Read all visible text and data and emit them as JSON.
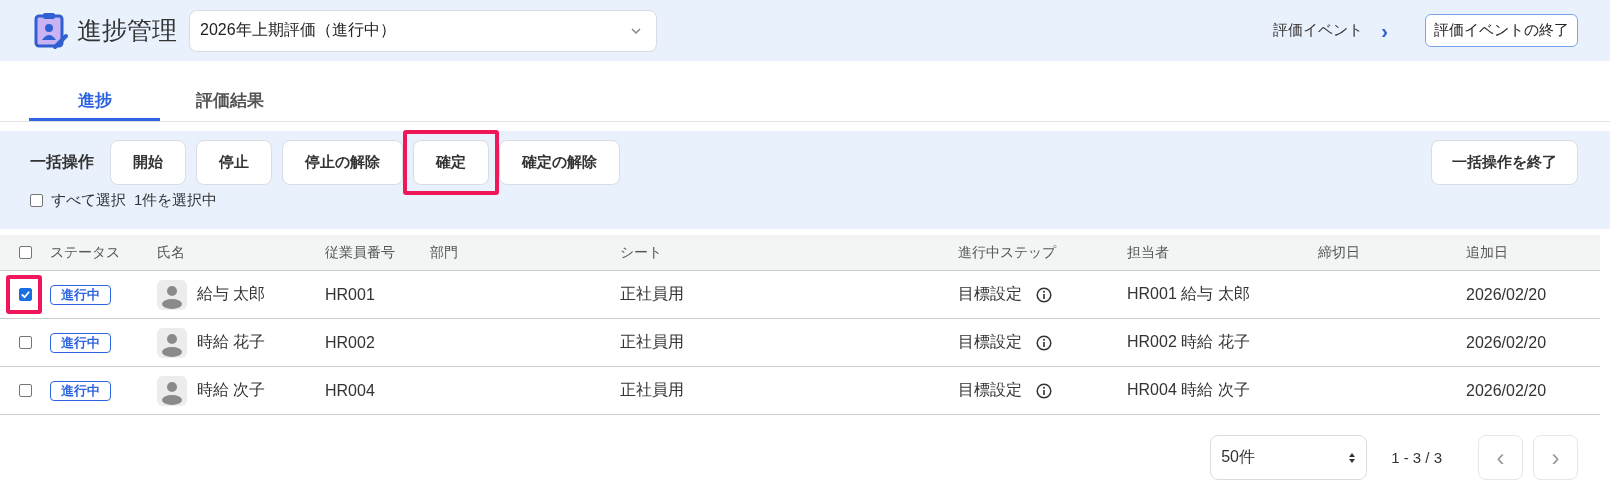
{
  "header": {
    "title": "進捗管理",
    "event_select": {
      "value": "2026年上期評価（進行中）"
    },
    "event_link": "評価イベント",
    "event_link_arrow": "›",
    "end_event_button": "評価イベントの終了"
  },
  "tabs": [
    {
      "label": "進捗",
      "selected": true
    },
    {
      "label": "評価結果",
      "selected": false
    }
  ],
  "bulk": {
    "label": "一括操作",
    "actions": [
      {
        "label": "開始",
        "highlighted": false
      },
      {
        "label": "停止",
        "highlighted": false
      },
      {
        "label": "停止の解除",
        "highlighted": false
      },
      {
        "label": "確定",
        "highlighted": true
      },
      {
        "label": "確定の解除",
        "highlighted": false
      }
    ],
    "end_button": "一括操作を終了",
    "select_all": {
      "label": "すべて選択",
      "checked": false
    },
    "selection_count": "1件を選択中"
  },
  "table": {
    "header_checked": false,
    "columns": [
      "ステータス",
      "氏名",
      "従業員番号",
      "部門",
      "シート",
      "進行中ステップ",
      "担当者",
      "締切日",
      "追加日"
    ],
    "rows": [
      {
        "checked": true,
        "highlighted": true,
        "status": "進行中",
        "name": "給与 太郎",
        "employee_no": "HR001",
        "sheet": "正社員用",
        "step": "目標設定",
        "assignee": "HR001 給与 太郎",
        "added": "2026/02/20"
      },
      {
        "checked": false,
        "highlighted": false,
        "status": "進行中",
        "name": "時給 花子",
        "employee_no": "HR002",
        "sheet": "正社員用",
        "step": "目標設定",
        "assignee": "HR002 時給 花子",
        "added": "2026/02/20"
      },
      {
        "checked": false,
        "highlighted": false,
        "status": "進行中",
        "name": "時給 次子",
        "employee_no": "HR004",
        "sheet": "正社員用",
        "step": "目標設定",
        "assignee": "HR004 時給 次子",
        "added": "2026/02/20"
      }
    ]
  },
  "pagination": {
    "page_size": "50件",
    "range": "1 - 3 / 3",
    "prev": "‹",
    "next": "›"
  }
}
